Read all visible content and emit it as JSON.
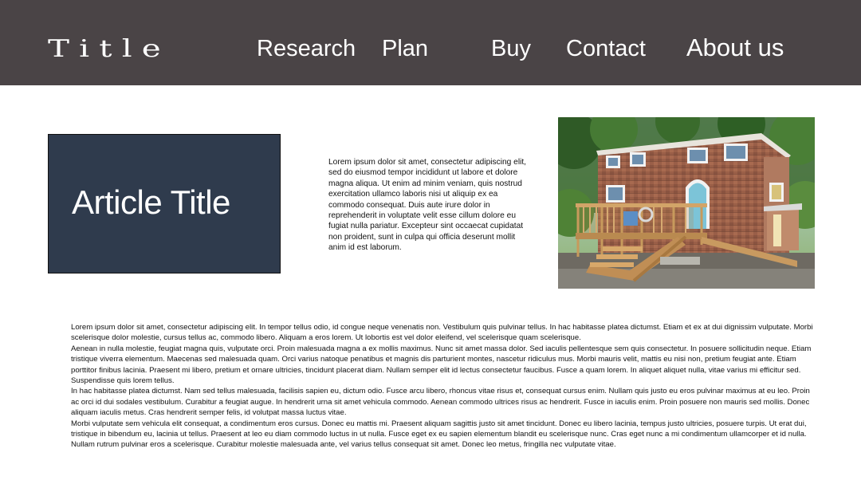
{
  "header": {
    "logo": "Title",
    "nav": [
      "Research",
      "Plan",
      "Buy",
      "Contact",
      "About us"
    ]
  },
  "colors": {
    "header_bg": "#4a4446",
    "article_box_bg": "#2f3b4d"
  },
  "article": {
    "title": "Article Title",
    "intro": "Lorem ipsum dolor sit amet, consectetur adipiscing elit, sed do eiusmod tempor incididunt ut labore et dolore magna aliqua. Ut enim ad minim veniam, quis nostrud exercitation ullamco laboris nisi ut aliquip ex ea commodo consequat. Duis aute irure dolor in reprehenderit in voluptate velit esse cillum dolore eu fugiat nulla pariatur. Excepteur sint occaecat cupidatat non proident, sunt in culpa qui officia deserunt mollit anim id est laborum.",
    "image_icon": "tiny-house-photo",
    "paragraphs": [
      "Lorem ipsum dolor sit amet, consectetur adipiscing elit. In tempor tellus odio, id congue neque venenatis non. Vestibulum quis pulvinar tellus. In hac habitasse platea dictumst. Etiam et ex at dui dignissim vulputate. Morbi scelerisque dolor molestie, cursus tellus ac, commodo libero. Aliquam a eros lorem. Ut lobortis est vel dolor eleifend, vel scelerisque quam scelerisque.",
      "Aenean in nulla molestie, feugiat magna quis, vulputate orci. Proin malesuada magna a ex mollis maximus. Nunc sit amet massa dolor. Sed iaculis pellentesque sem quis consectetur. In posuere sollicitudin neque. Etiam tristique viverra elementum. Maecenas sed malesuada quam. Orci varius natoque penatibus et magnis dis parturient montes, nascetur ridiculus mus. Morbi mauris velit, mattis eu nisi non, pretium feugiat ante. Etiam porttitor finibus lacinia. Praesent mi libero, pretium et ornare ultricies, tincidunt placerat diam. Nullam semper elit id lectus consectetur faucibus. Fusce a quam lorem. In aliquet aliquet nulla, vitae varius mi efficitur sed. Suspendisse quis lorem tellus.",
      "In hac habitasse platea dictumst. Nam sed tellus malesuada, facilisis sapien eu, dictum odio. Fusce arcu libero, rhoncus vitae risus et, consequat cursus enim. Nullam quis justo eu eros pulvinar maximus at eu leo. Proin ac orci id dui sodales vestibulum. Curabitur a feugiat augue. In hendrerit urna sit amet vehicula commodo. Aenean commodo ultrices risus ac hendrerit. Fusce in iaculis enim. Proin posuere non mauris sed mollis. Donec aliquam iaculis metus. Cras hendrerit semper felis, id volutpat massa luctus vitae.",
      "Morbi vulputate sem vehicula elit consequat, a condimentum eros cursus. Donec eu mattis mi. Praesent aliquam sagittis justo sit amet tincidunt. Donec eu libero lacinia, tempus justo ultricies, posuere turpis. Ut erat dui, tristique in bibendum eu, lacinia ut tellus. Praesent at leo eu diam commodo luctus in ut nulla. Fusce eget ex eu sapien elementum blandit eu scelerisque nunc. Cras eget nunc a mi condimentum ullamcorper et id nulla. Nullam rutrum pulvinar eros a scelerisque. Curabitur molestie malesuada ante, vel varius tellus consequat sit amet. Donec leo metus, fringilla nec vulputate vitae."
    ]
  }
}
